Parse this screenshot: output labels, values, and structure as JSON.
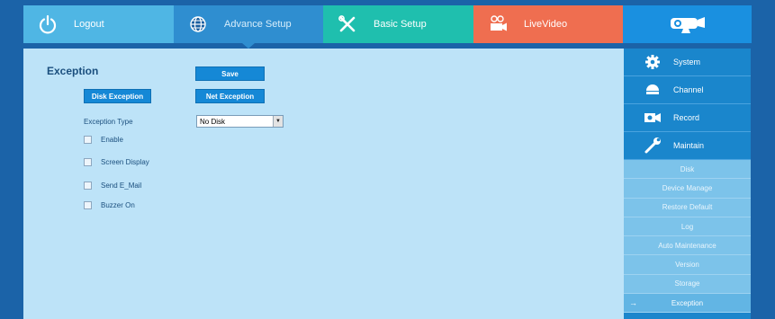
{
  "topnav": {
    "logout": "Logout",
    "advance_setup": "Advance Setup",
    "basic_setup": "Basic Setup",
    "live_video": "LiveVideo"
  },
  "colors": {
    "background": "#1b63a8",
    "panel": "#bde3f8",
    "logout_tab": "#4fb6e4",
    "advance_tab": "#2f8ed0",
    "basic_tab": "#1fbfae",
    "live_tab": "#ef6e50",
    "brand_tab": "#1a90e0",
    "button": "#1588d6"
  },
  "icons": {
    "logout": "power-icon",
    "advance_setup": "globe-icon",
    "basic_setup": "tools-icon",
    "live_video": "video-camera-icon",
    "brand": "cctv-camera-logo"
  },
  "main": {
    "title": "Exception",
    "save_button": "Save",
    "disk_exception_button": "Disk Exception",
    "net_exception_button": "Net Exception",
    "exception_type_label": "Exception Type",
    "exception_type_value": "No Disk",
    "options": [
      {
        "label": "Enable",
        "checked": false
      },
      {
        "label": "Screen Display",
        "checked": false
      },
      {
        "label": "Send E_Mail",
        "checked": false
      },
      {
        "label": "Buzzer On",
        "checked": false
      }
    ]
  },
  "sidebar": {
    "main_items": [
      {
        "label": "System",
        "icon": "gear-icon"
      },
      {
        "label": "Channel",
        "icon": "dome-camera-icon"
      },
      {
        "label": "Record",
        "icon": "record-camera-icon"
      },
      {
        "label": "Maintain",
        "icon": "wrench-icon"
      }
    ],
    "sub_items": [
      {
        "label": "Disk"
      },
      {
        "label": "Device Manage"
      },
      {
        "label": "Restore Default"
      },
      {
        "label": "Log"
      },
      {
        "label": "Auto Maintenance"
      },
      {
        "label": "Version"
      },
      {
        "label": "Storage"
      },
      {
        "label": "Exception",
        "selected": true
      }
    ],
    "selected_arrow": "→"
  }
}
